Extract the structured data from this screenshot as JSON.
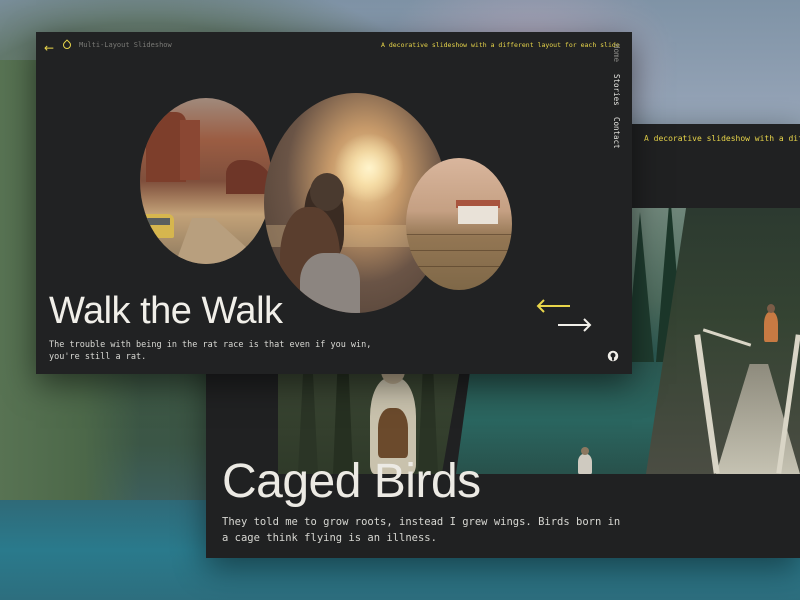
{
  "app": {
    "title": "Multi-Layout Slideshow",
    "tagline": "A decorative slideshow with a different layout for each slide",
    "tagline_back_visible": "A decorative slideshow with a different layout for each slide"
  },
  "nav": {
    "back_icon": "arrow-left-icon",
    "logo_icon": "droplet-icon",
    "items": [
      "Home",
      "Stories",
      "Contact"
    ],
    "github_icon": "github-icon"
  },
  "slides": {
    "front": {
      "title": "Walk the Walk",
      "text": "The trouble with being in the rat race is that even if you win, you're still a rat."
    },
    "back": {
      "title": "Caged Birds",
      "text": "They told me to grow roots, instead I grew wings. Birds born in a cage think flying is an illness."
    }
  },
  "controls": {
    "prev_icon": "arrow-left-long-icon",
    "next_icon": "arrow-right-long-icon"
  },
  "colors": {
    "accent": "#e8d54a",
    "card_bg": "#212223",
    "text_light": "#f1efe9"
  }
}
